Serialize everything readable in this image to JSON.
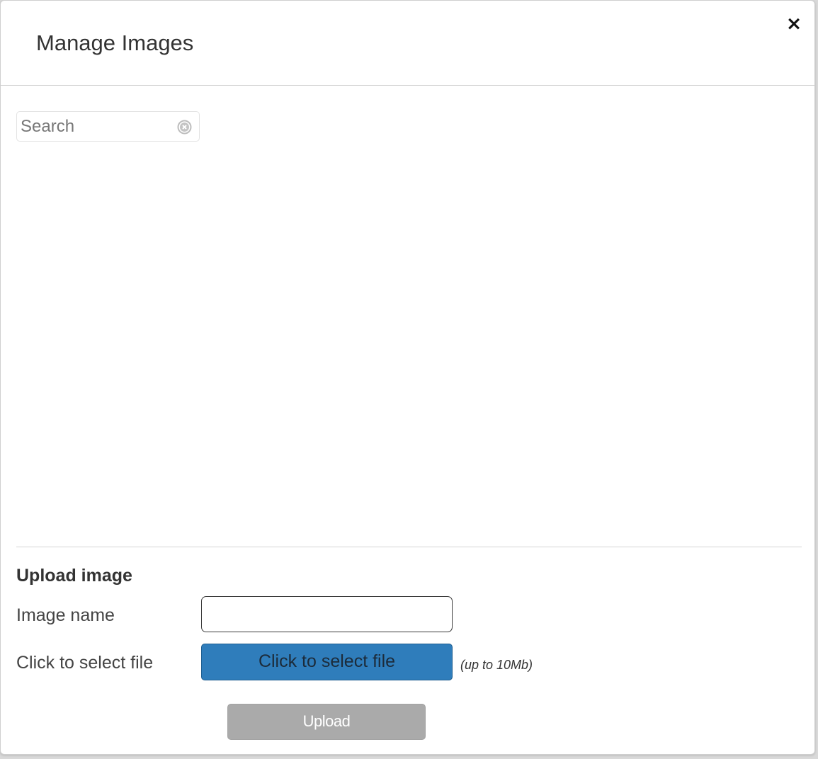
{
  "dialog": {
    "title": "Manage Images",
    "close_label": "×",
    "close_icon": "close-icon"
  },
  "search": {
    "placeholder": "Search",
    "value": "",
    "clear_icon": "clear-circle-icon"
  },
  "upload": {
    "section_title": "Upload image",
    "image_name_label": "Image name",
    "image_name_value": "",
    "file_label": "Click to select file",
    "file_button_label": "Click to select file",
    "file_hint": "(up to 10Mb)",
    "upload_button_label": "Upload",
    "upload_enabled": false
  },
  "colors": {
    "accent": "#2f7dbb",
    "disabled_button": "#aaaaaa",
    "border": "#cfcfcf"
  }
}
